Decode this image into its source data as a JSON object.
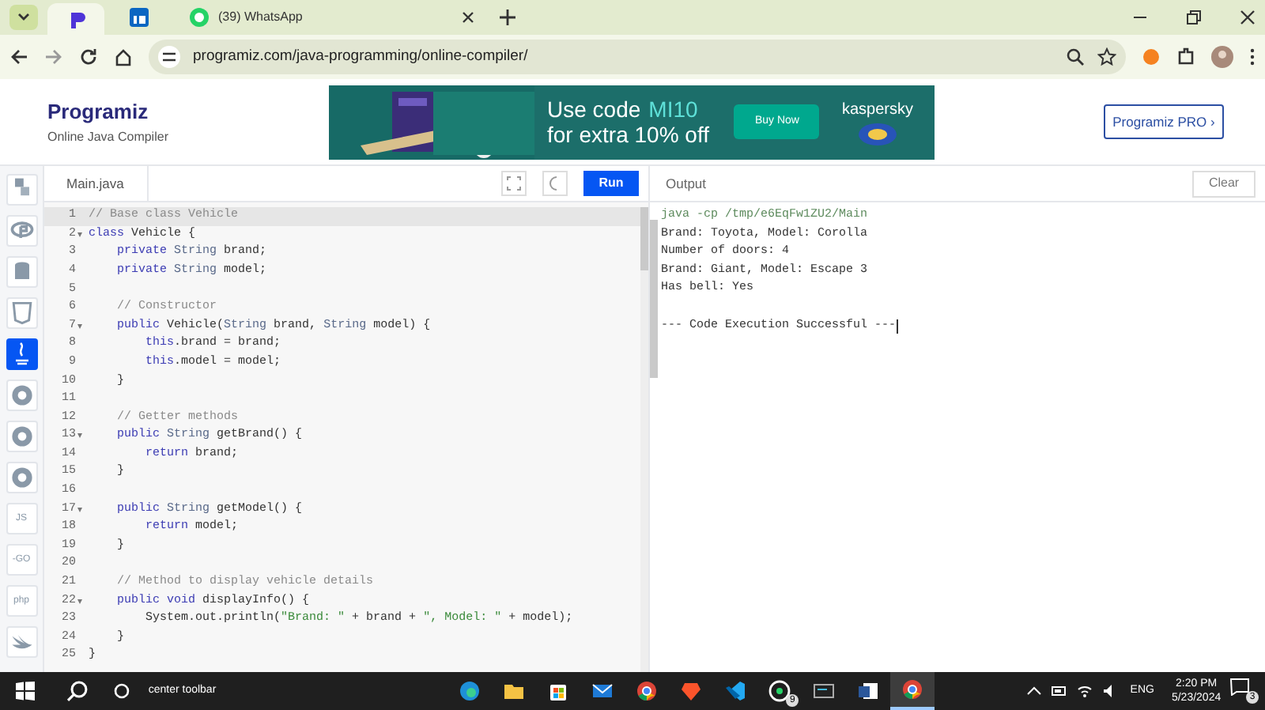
{
  "browser": {
    "tabs": [
      {
        "kind": "programiz",
        "selected": true
      },
      {
        "kind": "linkedin",
        "selected": false
      },
      {
        "kind": "whatsapp",
        "title": "(39) WhatsApp",
        "selected": false
      }
    ],
    "url": "programiz.com/java-programming/online-compiler/"
  },
  "header": {
    "logo": "Programiz",
    "subtitle": "Online Java Compiler",
    "pro_button": "Programiz PRO ›"
  },
  "ad": {
    "line1": "Use code",
    "code": "MI10",
    "line2": "for extra 10% off",
    "cta": "Buy Now",
    "brand": "kaspersky"
  },
  "languages": [
    {
      "kind": "python",
      "selected": false
    },
    {
      "kind": "r",
      "selected": false
    },
    {
      "kind": "sql",
      "selected": false
    },
    {
      "kind": "html",
      "selected": false
    },
    {
      "kind": "java",
      "selected": true
    },
    {
      "kind": "c",
      "selected": false
    },
    {
      "kind": "cpp",
      "selected": false
    },
    {
      "kind": "csharp",
      "selected": false
    },
    {
      "kind": "text",
      "label": "JS",
      "selected": false
    },
    {
      "kind": "text",
      "label": "-GO",
      "selected": false
    },
    {
      "kind": "text",
      "label": "php",
      "selected": false
    },
    {
      "kind": "swift",
      "selected": false
    }
  ],
  "editor": {
    "file_tab": "Main.java",
    "run_button": "Run",
    "lines": [
      {
        "number": "1",
        "foldable": false,
        "selected": true,
        "tokens": [
          {
            "kind": "comment",
            "text": "// Base class Vehicle"
          }
        ]
      },
      {
        "number": "2",
        "foldable": true,
        "selected": false,
        "tokens": [
          {
            "kind": "keyword",
            "text": "class"
          },
          {
            "kind": "plain",
            "text": " Vehicle {"
          }
        ]
      },
      {
        "number": "3",
        "foldable": false,
        "selected": false,
        "tokens": [
          {
            "kind": "keyword",
            "text": "    private"
          },
          {
            "kind": "type",
            "text": " String"
          },
          {
            "kind": "plain",
            "text": " brand;"
          }
        ]
      },
      {
        "number": "4",
        "foldable": false,
        "selected": false,
        "tokens": [
          {
            "kind": "keyword",
            "text": "    private"
          },
          {
            "kind": "type",
            "text": " String"
          },
          {
            "kind": "plain",
            "text": " model;"
          }
        ]
      },
      {
        "number": "5",
        "foldable": false,
        "selected": false
      },
      {
        "number": "6",
        "foldable": false,
        "selected": false,
        "tokens": [
          {
            "kind": "comment",
            "text": "    // Constructor"
          }
        ]
      },
      {
        "number": "7",
        "foldable": true,
        "selected": false,
        "tokens": [
          {
            "kind": "keyword",
            "text": "    public"
          },
          {
            "kind": "plain",
            "text": " Vehicle("
          },
          {
            "kind": "type",
            "text": "String"
          },
          {
            "kind": "plain",
            "text": " brand, "
          },
          {
            "kind": "type",
            "text": "String"
          },
          {
            "kind": "plain",
            "text": " model) {"
          }
        ]
      },
      {
        "number": "8",
        "foldable": false,
        "selected": false,
        "tokens": [
          {
            "kind": "keyword",
            "text": "        this"
          },
          {
            "kind": "plain",
            "text": ".brand = brand;"
          }
        ]
      },
      {
        "number": "9",
        "foldable": false,
        "selected": false,
        "tokens": [
          {
            "kind": "keyword",
            "text": "        this"
          },
          {
            "kind": "plain",
            "text": ".model = model;"
          }
        ]
      },
      {
        "number": "10",
        "foldable": false,
        "selected": false,
        "tokens": [
          {
            "kind": "plain",
            "text": "    }"
          }
        ]
      },
      {
        "number": "11",
        "foldable": false,
        "selected": false
      },
      {
        "number": "12",
        "foldable": false,
        "selected": false,
        "tokens": [
          {
            "kind": "comment",
            "text": "    // Getter methods"
          }
        ]
      },
      {
        "number": "13",
        "foldable": true,
        "selected": false,
        "tokens": [
          {
            "kind": "keyword",
            "text": "    public"
          },
          {
            "kind": "type",
            "text": " String"
          },
          {
            "kind": "plain",
            "text": " getBrand() {"
          }
        ]
      },
      {
        "number": "14",
        "foldable": false,
        "selected": false,
        "tokens": [
          {
            "kind": "keyword",
            "text": "        return"
          },
          {
            "kind": "plain",
            "text": " brand;"
          }
        ]
      },
      {
        "number": "15",
        "foldable": false,
        "selected": false,
        "tokens": [
          {
            "kind": "plain",
            "text": "    }"
          }
        ]
      },
      {
        "number": "16",
        "foldable": false,
        "selected": false
      },
      {
        "number": "17",
        "foldable": true,
        "selected": false,
        "tokens": [
          {
            "kind": "keyword",
            "text": "    public"
          },
          {
            "kind": "type",
            "text": " String"
          },
          {
            "kind": "plain",
            "text": " getModel() {"
          }
        ]
      },
      {
        "number": "18",
        "foldable": false,
        "selected": false,
        "tokens": [
          {
            "kind": "keyword",
            "text": "        return"
          },
          {
            "kind": "plain",
            "text": " model;"
          }
        ]
      },
      {
        "number": "19",
        "foldable": false,
        "selected": false,
        "tokens": [
          {
            "kind": "plain",
            "text": "    }"
          }
        ]
      },
      {
        "number": "20",
        "foldable": false,
        "selected": false
      },
      {
        "number": "21",
        "foldable": false,
        "selected": false,
        "tokens": [
          {
            "kind": "comment",
            "text": "    // Method to display vehicle details"
          }
        ]
      },
      {
        "number": "22",
        "foldable": true,
        "selected": false,
        "tokens": [
          {
            "kind": "keyword",
            "text": "    public void"
          },
          {
            "kind": "plain",
            "text": " displayInfo() {"
          }
        ]
      },
      {
        "number": "23",
        "foldable": false,
        "selected": false,
        "tokens": [
          {
            "kind": "plain",
            "text": "        System.out.println("
          },
          {
            "kind": "string",
            "text": "\"Brand: \""
          },
          {
            "kind": "plain",
            "text": " + brand + "
          },
          {
            "kind": "string",
            "text": "\", Model: \""
          },
          {
            "kind": "plain",
            "text": " + model);"
          }
        ]
      },
      {
        "number": "24",
        "foldable": false,
        "selected": false,
        "tokens": [
          {
            "kind": "plain",
            "text": "    }"
          }
        ]
      },
      {
        "number": "25",
        "foldable": false,
        "selected": false,
        "tokens": [
          {
            "kind": "plain",
            "text": "}"
          }
        ]
      }
    ]
  },
  "output": {
    "title": "Output",
    "clear_button": "Clear",
    "lines": [
      {
        "kind": "command",
        "text": "java -cp /tmp/e6EqFw1ZU2/Main"
      },
      {
        "kind": "plain",
        "text": "Brand: Toyota, Model: Corolla"
      },
      {
        "kind": "plain",
        "text": "Number of doors: 4"
      },
      {
        "kind": "plain",
        "text": "Brand: Giant, Model: Escape 3"
      },
      {
        "kind": "plain",
        "text": "Has bell: Yes"
      },
      {
        "kind": "blank"
      },
      {
        "kind": "plain",
        "text": "--- Code Execution Successful ---"
      }
    ]
  },
  "taskbar": {
    "search_text": "center toolbar",
    "apps": [
      {
        "kind": "edge",
        "selected": false
      },
      {
        "kind": "folder",
        "selected": false
      },
      {
        "kind": "store",
        "selected": false
      },
      {
        "kind": "mail",
        "selected": false
      },
      {
        "kind": "chrome",
        "selected": false
      },
      {
        "kind": "brave",
        "selected": false
      },
      {
        "kind": "vscode",
        "selected": false
      },
      {
        "kind": "whatsapp",
        "badge": "9",
        "selected": false
      },
      {
        "kind": "terminal",
        "selected": false
      },
      {
        "kind": "word",
        "selected": false
      },
      {
        "kind": "chrome",
        "selected": true
      }
    ],
    "language": "ENG",
    "time": "2:20 PM",
    "date": "5/23/2024",
    "notifications": "3"
  }
}
